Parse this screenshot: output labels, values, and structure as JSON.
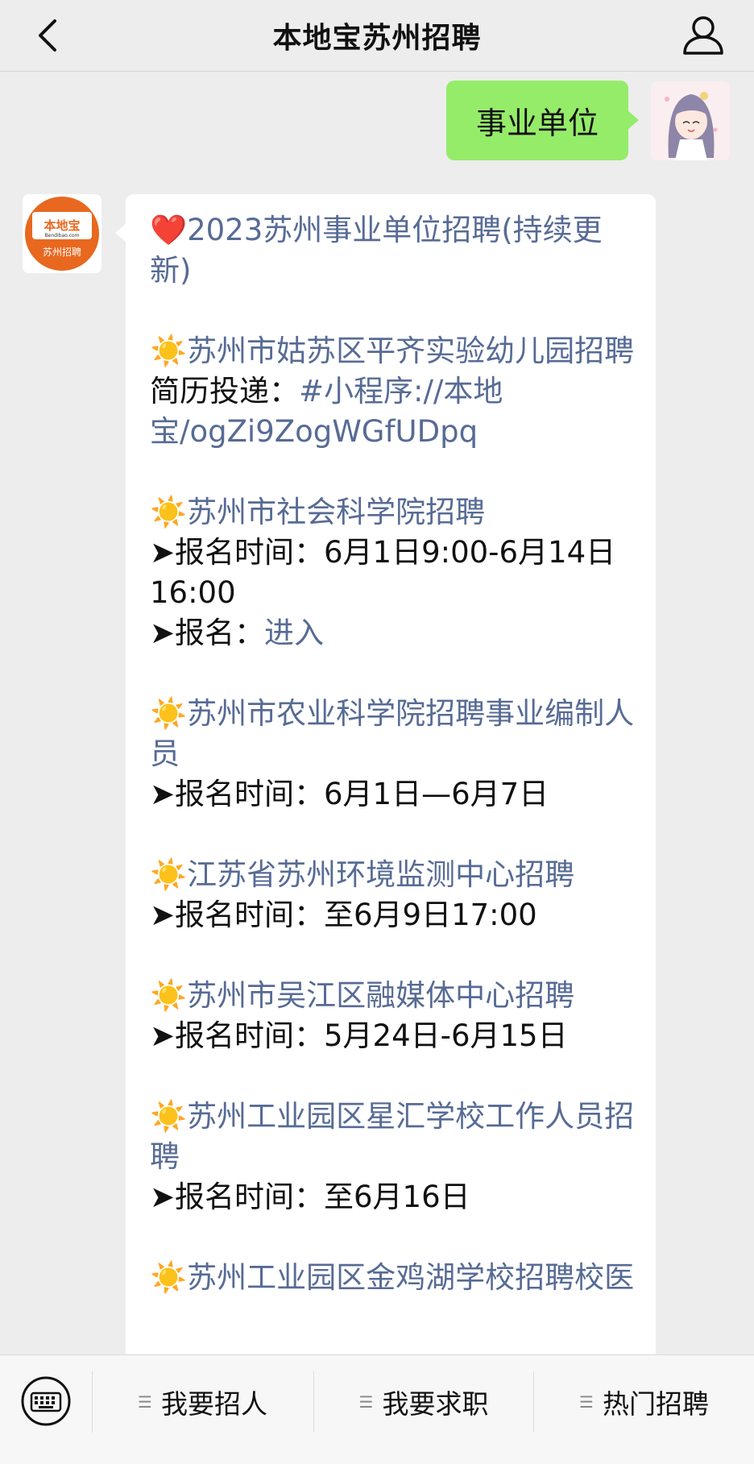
{
  "header": {
    "title": "本地宝苏州招聘",
    "back_icon": "chevron-left-icon",
    "user_icon": "user-icon"
  },
  "user_message": {
    "text": "事业单位"
  },
  "bot_avatar": {
    "brand_cn": "本地宝",
    "brand_en": "Bendibao.com",
    "sub": "苏州招聘"
  },
  "bot_message": {
    "headline": {
      "emoji": "❤️",
      "text": "2023苏州事业单位招聘(持续更新)"
    },
    "entries": [
      {
        "emoji": "☀️",
        "title": "苏州市姑苏区平齐实验幼儿园招聘",
        "resume_label": " 简历投递：",
        "resume_link": "#小程序://本地宝/ogZi9ZogWGfUDpq"
      },
      {
        "emoji": "☀️",
        "title": "苏州市社会科学院招聘",
        "time": "➤报名时间：6月1日9:00-6月14日16:00",
        "signup_label": "➤报名：",
        "signup_link": "进入"
      },
      {
        "emoji": "☀️",
        "title": "苏州市农业科学院招聘事业编制人员",
        "time": "➤报名时间：6月1日—6月7日"
      },
      {
        "emoji": "☀️",
        "title": "江苏省苏州环境监测中心招聘",
        "time": "➤报名时间：至6月9日17:00"
      },
      {
        "emoji": "☀️",
        "title": "苏州市吴江区融媒体中心招聘",
        "time": "➤报名时间：5月24日-6月15日"
      },
      {
        "emoji": "☀️",
        "title": "苏州工业园区星汇学校工作人员招聘",
        "time": "➤报名时间：至6月16日"
      },
      {
        "emoji": "☀️",
        "title": "苏州工业园区金鸡湖学校招聘校医"
      }
    ]
  },
  "bottom_bar": {
    "keyboard_icon": "keyboard-icon",
    "menus": [
      {
        "label": "我要招人",
        "icon": "menu-lines-icon"
      },
      {
        "label": "我要求职",
        "icon": "menu-lines-icon"
      },
      {
        "label": "热门招聘",
        "icon": "menu-lines-icon"
      }
    ]
  },
  "colors": {
    "link": "#576b95",
    "user_bubble": "#95ec69",
    "background": "#ededed",
    "brand_orange": "#e8681f"
  }
}
